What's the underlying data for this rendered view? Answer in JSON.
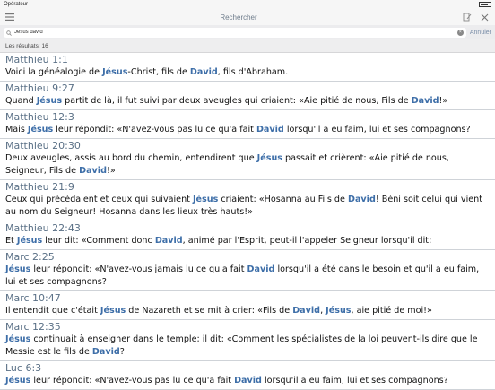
{
  "status": {
    "carrier": "Opérateur"
  },
  "header": {
    "title": "Rechercher"
  },
  "search": {
    "value": "Jésus david",
    "placeholder": "",
    "cancel_label": "Annuler"
  },
  "results_label": "Les résultats: 16",
  "results": [
    {
      "ref": "Matthieu 1:1",
      "segments": [
        [
          "Voici la généalogie de ",
          false
        ],
        [
          "Jésus",
          true
        ],
        [
          "-Christ, fils de ",
          false
        ],
        [
          "David",
          true
        ],
        [
          ", fils d'Abraham.",
          false
        ]
      ]
    },
    {
      "ref": "Matthieu 9:27",
      "segments": [
        [
          "Quand ",
          false
        ],
        [
          "Jésus",
          true
        ],
        [
          " partit de là, il fut suivi par deux aveugles qui criaient: «Aie pitié de nous, Fils de ",
          false
        ],
        [
          "David",
          true
        ],
        [
          "!»",
          false
        ]
      ]
    },
    {
      "ref": "Matthieu 12:3",
      "segments": [
        [
          "Mais ",
          false
        ],
        [
          "Jésus",
          true
        ],
        [
          " leur répondit: «N'avez-vous pas lu ce qu'a fait ",
          false
        ],
        [
          "David",
          true
        ],
        [
          " lorsqu'il a eu faim, lui et ses compagnons?",
          false
        ]
      ]
    },
    {
      "ref": "Matthieu 20:30",
      "segments": [
        [
          "Deux aveugles, assis au bord du chemin, entendirent que ",
          false
        ],
        [
          "Jésus",
          true
        ],
        [
          " passait et crièrent: «Aie pitié de nous, Seigneur, Fils de ",
          false
        ],
        [
          "David",
          true
        ],
        [
          "!»",
          false
        ]
      ]
    },
    {
      "ref": "Matthieu 21:9",
      "segments": [
        [
          "Ceux qui précédaient et ceux qui suivaient ",
          false
        ],
        [
          "Jésus",
          true
        ],
        [
          " criaient: «Hosanna au Fils de ",
          false
        ],
        [
          "David",
          true
        ],
        [
          "! Béni soit celui qui vient au nom du Seigneur! Hosanna dans les lieux très hauts!»",
          false
        ]
      ]
    },
    {
      "ref": "Matthieu 22:43",
      "segments": [
        [
          "Et ",
          false
        ],
        [
          "Jésus",
          true
        ],
        [
          " leur dit: «Comment donc ",
          false
        ],
        [
          "David",
          true
        ],
        [
          ", animé par l'Esprit, peut-il l'appeler Seigneur lorsqu'il dit:",
          false
        ]
      ]
    },
    {
      "ref": "Marc 2:25",
      "segments": [
        [
          "Jésus",
          true
        ],
        [
          " leur répondit: «N'avez-vous jamais lu ce qu'a fait ",
          false
        ],
        [
          "David",
          true
        ],
        [
          " lorsqu'il a été dans le besoin et qu'il a eu faim, lui et ses compagnons?",
          false
        ]
      ]
    },
    {
      "ref": "Marc 10:47",
      "segments": [
        [
          "Il entendit que c'était ",
          false
        ],
        [
          "Jésus",
          true
        ],
        [
          " de Nazareth et se mit à crier: «Fils de ",
          false
        ],
        [
          "David",
          true
        ],
        [
          ", ",
          false
        ],
        [
          "Jésus",
          true
        ],
        [
          ", aie pitié de moi!»",
          false
        ]
      ]
    },
    {
      "ref": "Marc 12:35",
      "segments": [
        [
          "Jésus",
          true
        ],
        [
          " continuait à enseigner dans le temple; il dit: «Comment les spécialistes de la loi peuvent-ils dire que le Messie est le fils de ",
          false
        ],
        [
          "David",
          true
        ],
        [
          "?",
          false
        ]
      ]
    },
    {
      "ref": "Luc 6:3",
      "segments": [
        [
          "Jésus",
          true
        ],
        [
          " leur répondit: «N'avez-vous pas lu ce qu'a fait ",
          false
        ],
        [
          "David",
          true
        ],
        [
          " lorsqu'il a eu faim, lui et ses compagnons?",
          false
        ]
      ]
    }
  ],
  "icons": {
    "menu": "menu-icon",
    "settings": "settings-icon",
    "close": "close-icon",
    "search": "search-icon"
  },
  "colors": {
    "highlight": "#3d6ea8",
    "reference": "#5a7086"
  }
}
